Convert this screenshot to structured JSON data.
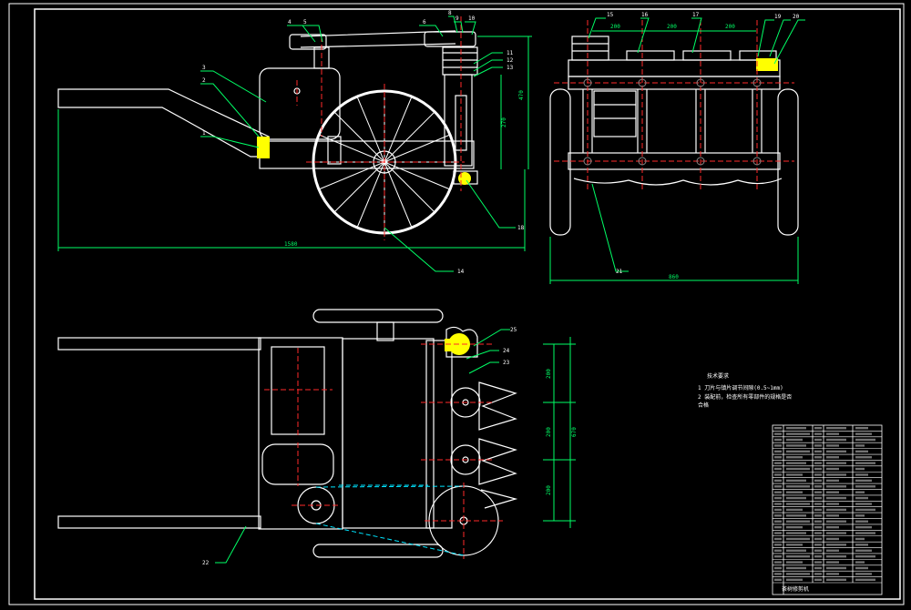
{
  "drawing": {
    "balloons": [
      "4",
      "5",
      "6",
      "8",
      "9",
      "10",
      "11",
      "12",
      "3",
      "2",
      "1",
      "13",
      "14",
      "15",
      "16",
      "17",
      "18",
      "19",
      "20",
      "21",
      "22",
      "23",
      "24",
      "25"
    ],
    "dims": {
      "overall_length": "1580",
      "track_width": "860",
      "height_a": "470",
      "height_b": "270",
      "spacing_a": "200",
      "spacing_b": "200",
      "spacing_c": "200",
      "plan_a": "200",
      "plan_b": "200",
      "plan_c": "200",
      "plan_total": "670"
    },
    "tech_title": "技术要求",
    "tech_lines": [
      "1 刀片与镇片调节间隙(0.5~1mm)",
      "2 装配前，检查所有零部件的规格是否",
      "   合格"
    ],
    "title_block_name": "茶树修剪机"
  },
  "colors": {
    "outline": "#ffffff",
    "center": "#ff2a2a",
    "dimension": "#00ff66",
    "leader": "#00ff66",
    "hidden": "#00e5ff",
    "part": "#ffff00",
    "frame": "#ffffff"
  }
}
